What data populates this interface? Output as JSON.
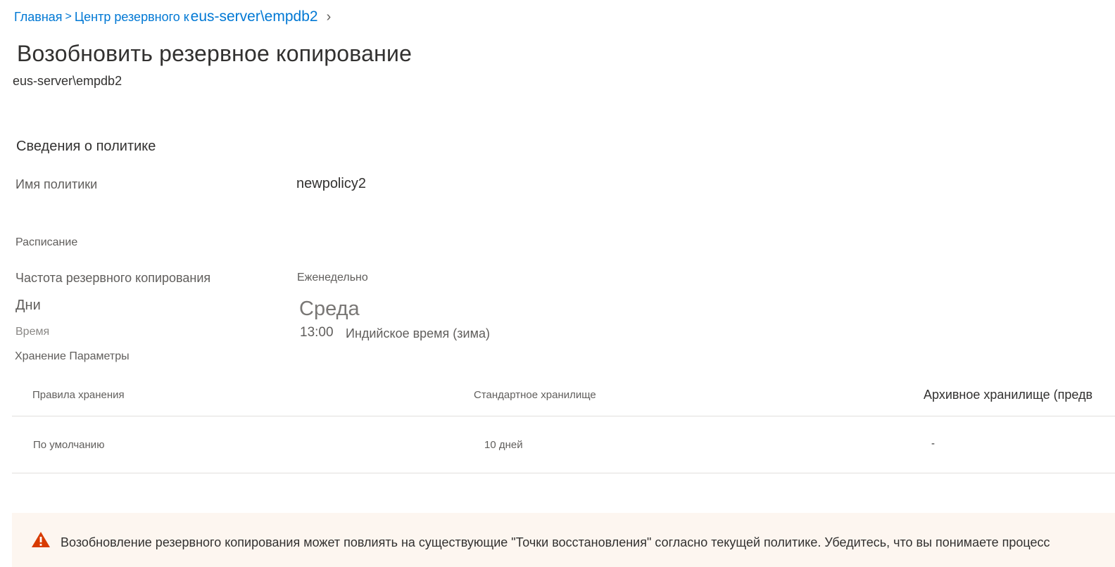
{
  "breadcrumb": {
    "home": "Главная",
    "separator": ">",
    "center": "Центр резервного к",
    "current": "eus-server\\empdb2",
    "chevron": "›"
  },
  "page": {
    "title": "Возобновить резервное копирование",
    "subtitle": "eus-server\\empdb2"
  },
  "policy": {
    "section_title": "Сведения о политике",
    "name_label": "Имя политики",
    "name_value": "newpolicy2",
    "schedule_label": "Расписание",
    "frequency_label": "Частота резервного копирования",
    "frequency_value": "Еженедельно",
    "days_label": "Дни",
    "days_value": "Среда",
    "time_label": "Время",
    "time_value": "13:00",
    "timezone_value": "Индийское время (зима)",
    "retention_label": "Хранение Параметры"
  },
  "retention_table": {
    "headers": [
      "Правила хранения",
      "Стандартное хранилище",
      "Архивное хранилище (предв"
    ],
    "rows": [
      [
        "По умолчанию",
        "10 дней",
        "-"
      ]
    ]
  },
  "warning": {
    "text": "Возобновление резервного копирования может повлиять на существующие \"Точки восстановления\" согласно текущей политике. Убедитесь, что вы понимаете процесс",
    "icon": "warning-icon",
    "color": "#d83b01"
  }
}
